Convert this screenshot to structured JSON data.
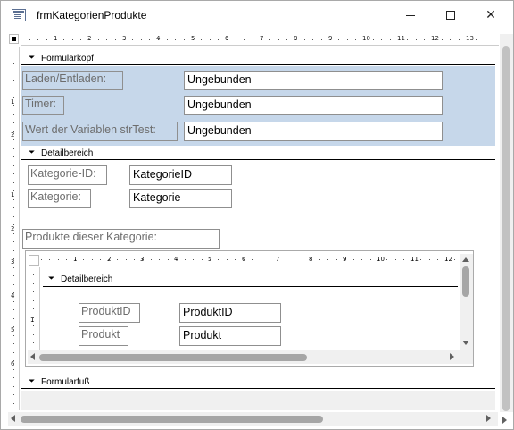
{
  "window": {
    "title": "frmKategorienProdukte",
    "minimize_label": "—",
    "maximize_label": "☐",
    "close_label": "✕"
  },
  "rulers": {
    "horizontal_numbers": [
      "1",
      "2",
      "3",
      "4",
      "5",
      "6",
      "7",
      "8",
      "9",
      "10",
      "11",
      "12",
      "13"
    ],
    "vertical_numbers": [
      "1",
      "2",
      "1",
      "2",
      "3",
      "4",
      "5",
      "6"
    ],
    "sub_horizontal_numbers": [
      "1",
      "2",
      "3",
      "4",
      "5",
      "6",
      "7",
      "8",
      "9",
      "10",
      "11",
      "12"
    ]
  },
  "sections": {
    "header": "Formularkopf",
    "detail": "Detailbereich",
    "footer": "Formularfuß",
    "sub_detail": "Detailbereich"
  },
  "header_controls": {
    "laden_label": "Laden/Entladen:",
    "laden_value": "Ungebunden",
    "timer_label": "Timer:",
    "timer_value": "Ungebunden",
    "var_label": "Wert der Variablen strTest:",
    "var_value": "Ungebunden"
  },
  "detail_controls": {
    "kategorie_id_label": "Kategorie-ID:",
    "kategorie_id_value": "KategorieID",
    "kategorie_label": "Kategorie:",
    "kategorie_value": "Kategorie",
    "produkte_label": "Produkte dieser Kategorie:"
  },
  "subform_controls": {
    "produkt_id_label": "ProduktID",
    "produkt_id_value": "ProduktID",
    "produkt_label": "Produkt",
    "produkt_value": "Produkt"
  },
  "colors": {
    "header_bg": "#c6d7ea",
    "label_text": "#6d6d6d",
    "scroll_thumb": "#a6a6a6"
  }
}
